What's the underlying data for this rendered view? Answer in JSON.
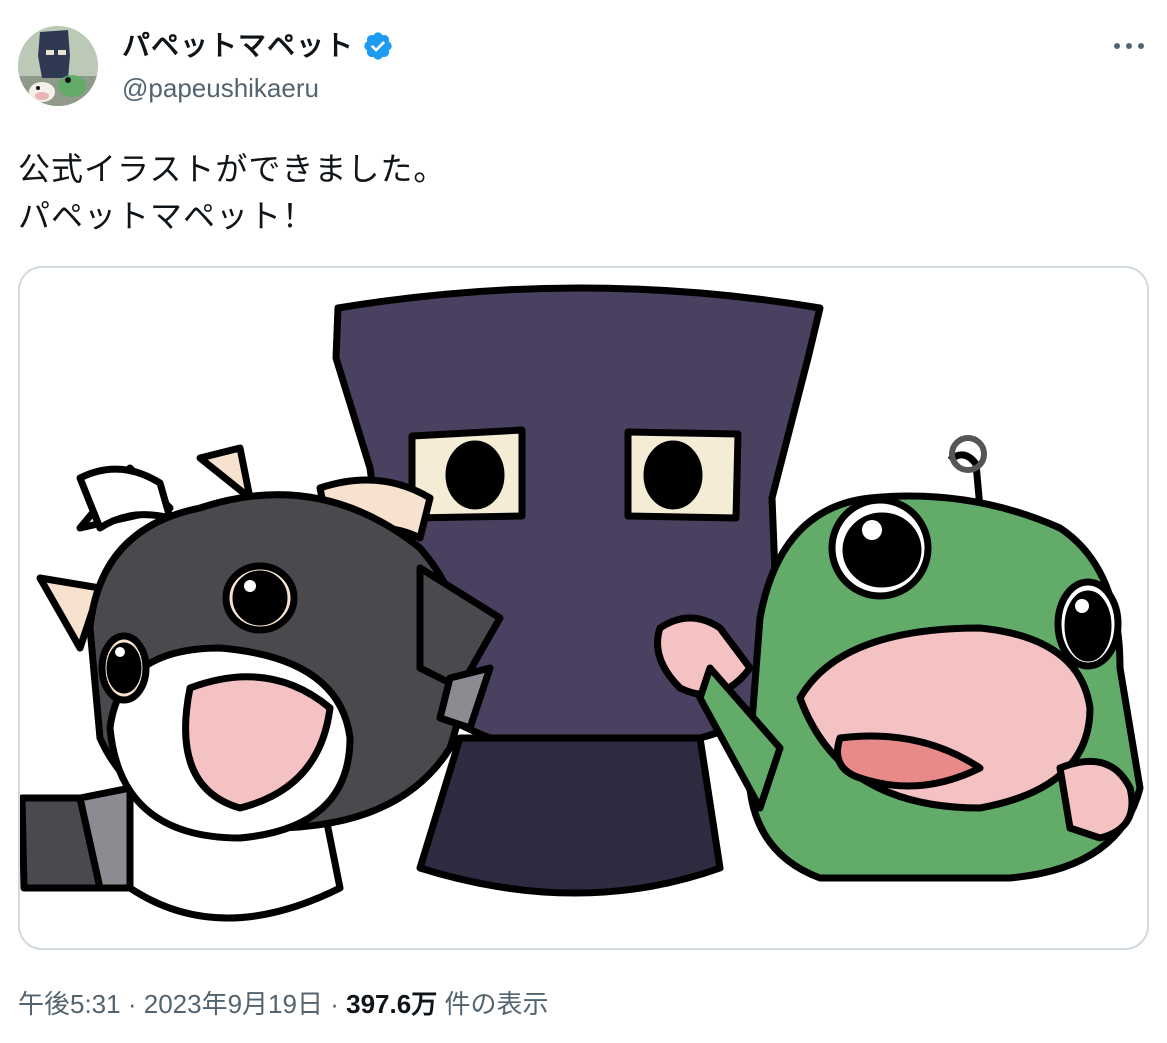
{
  "author": {
    "display_name": "パペットマペット",
    "handle": "@papeushikaeru",
    "verified": true,
    "verified_color": "#1d9bf0"
  },
  "tweet": {
    "lines": [
      "公式イラストができました。",
      "パペットマペット！"
    ]
  },
  "meta": {
    "time": "午後5:31",
    "separator": "·",
    "date": "2023年9月19日",
    "views_count": "397.6万",
    "views_label": "件の表示"
  },
  "icons": {
    "more": "more-icon",
    "verified": "verified-badge-icon"
  },
  "colors": {
    "text": "#0f1419",
    "secondary": "#536471",
    "border": "#cfd9de",
    "frog": "#62ab69",
    "bag": "#4a4060",
    "cow_dark": "#4a4a4e"
  }
}
